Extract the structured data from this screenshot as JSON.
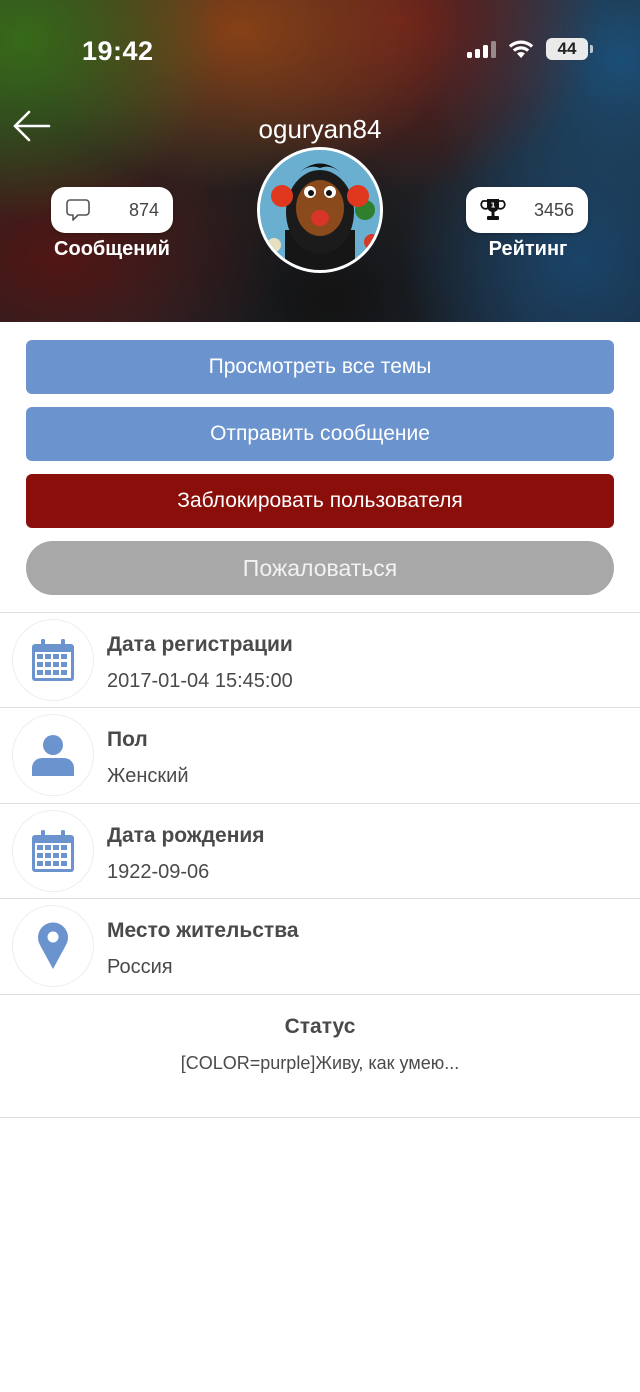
{
  "status_bar": {
    "time": "19:42",
    "battery": "44",
    "icons": [
      "signal-icon",
      "wifi-icon",
      "battery-icon"
    ]
  },
  "header": {
    "username": "oguryan84",
    "back_icon": "arrow-left-icon",
    "messages": {
      "value": "874",
      "label": "Сообщений",
      "icon": "chat-bubble-icon"
    },
    "rating": {
      "value": "3456",
      "label": "Рейтинг",
      "icon": "trophy-icon"
    }
  },
  "actions": {
    "view_topics": "Просмотреть все темы",
    "send_message": "Отправить сообщение",
    "block_user": "Заблокировать пользователя",
    "report": "Пожаловаться"
  },
  "info": [
    {
      "title": "Дата регистрации",
      "value": "2017-01-04 15:45:00",
      "icon": "calendar-icon"
    },
    {
      "title": "Пол",
      "value": "Женский",
      "icon": "person-icon"
    },
    {
      "title": "Дата рождения",
      "value": "1922-09-06",
      "icon": "calendar-icon"
    },
    {
      "title": "Место жительства",
      "value": "Россия",
      "icon": "map-pin-icon"
    }
  ],
  "status": {
    "title": "Статус",
    "text": "[COLOR=purple]Живу, как умею..."
  },
  "colors": {
    "primary_button": "#6b94cf",
    "danger_button": "#8a0f0a",
    "disabled_button": "#a8a8a8",
    "icon_blue": "#6b94cf"
  }
}
